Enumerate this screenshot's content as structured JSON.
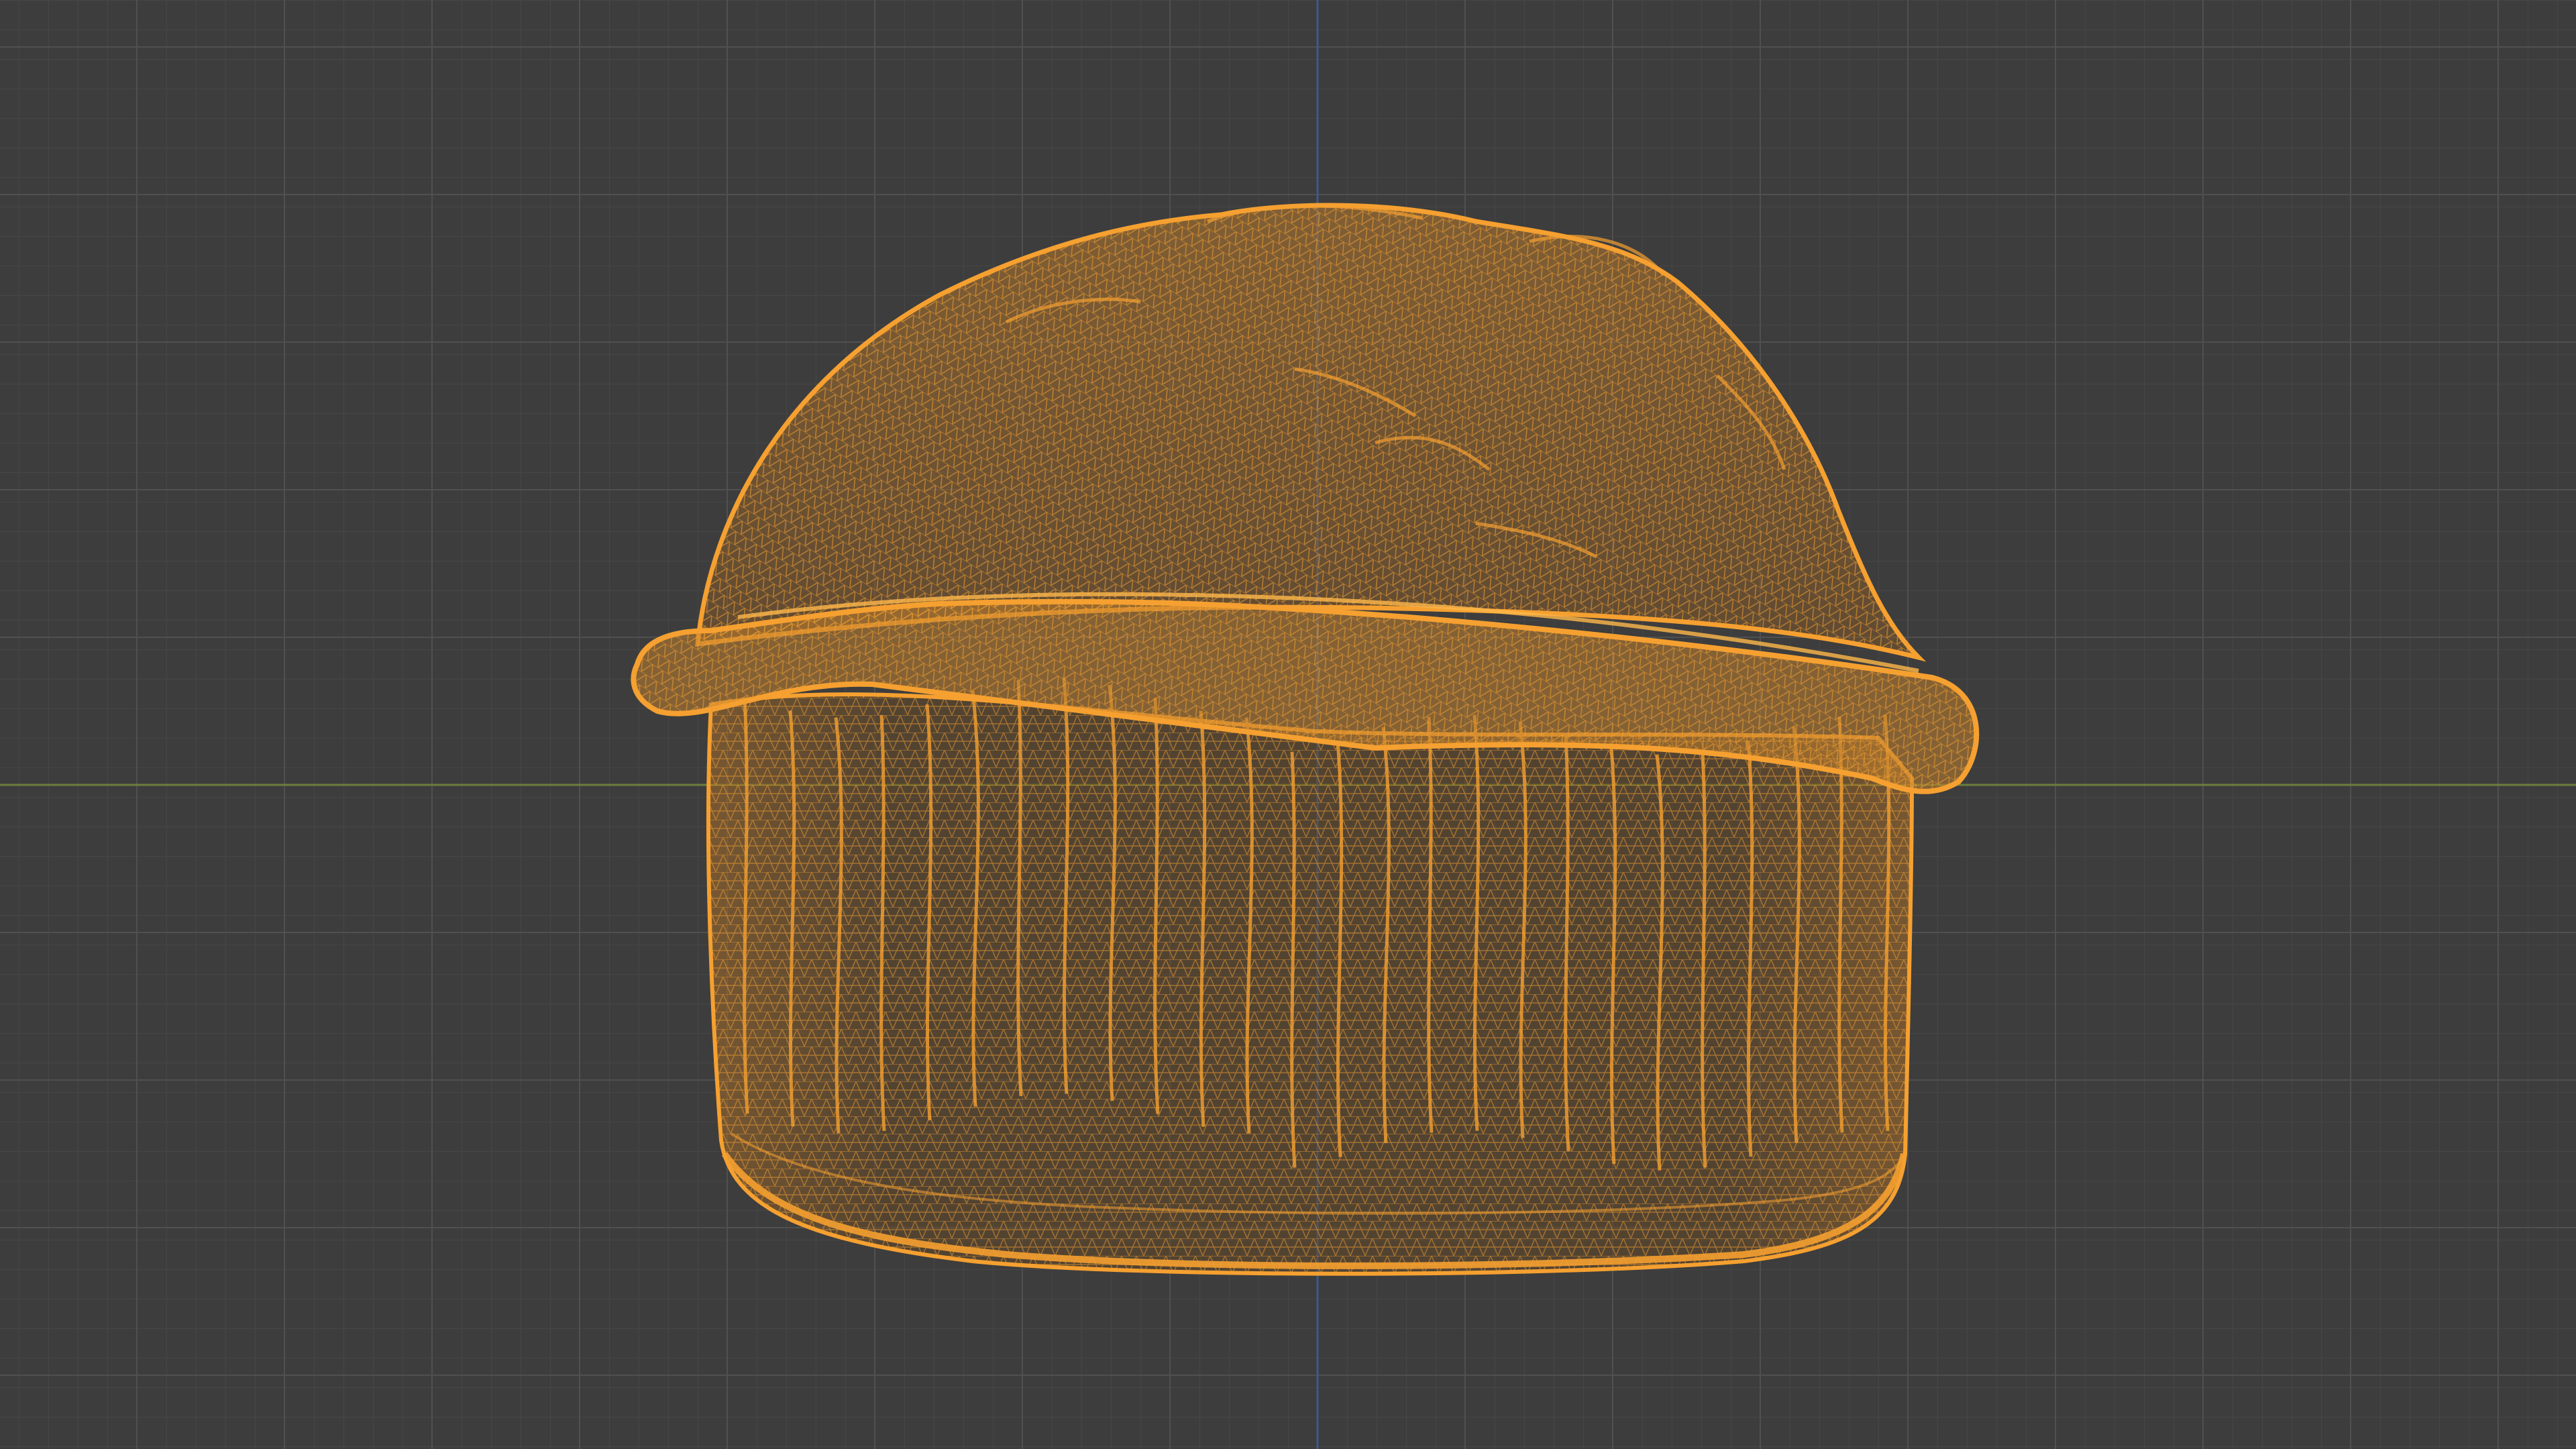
{
  "viewport": {
    "mode": "wireframe",
    "view": "front-orthographic",
    "background_color": "#3d3d3d",
    "grid": {
      "visible": true,
      "minor_color": "#444444",
      "major_color": "#4d4d4d",
      "x_axis_color": "#6b7f3a",
      "z_axis_color": "#3f5a86"
    },
    "object": {
      "name": "muffin-mesh",
      "selected": true,
      "wire_color": "#f5a030",
      "parts": [
        "muffin-top",
        "muffin-rim",
        "muffin-liner"
      ]
    }
  }
}
